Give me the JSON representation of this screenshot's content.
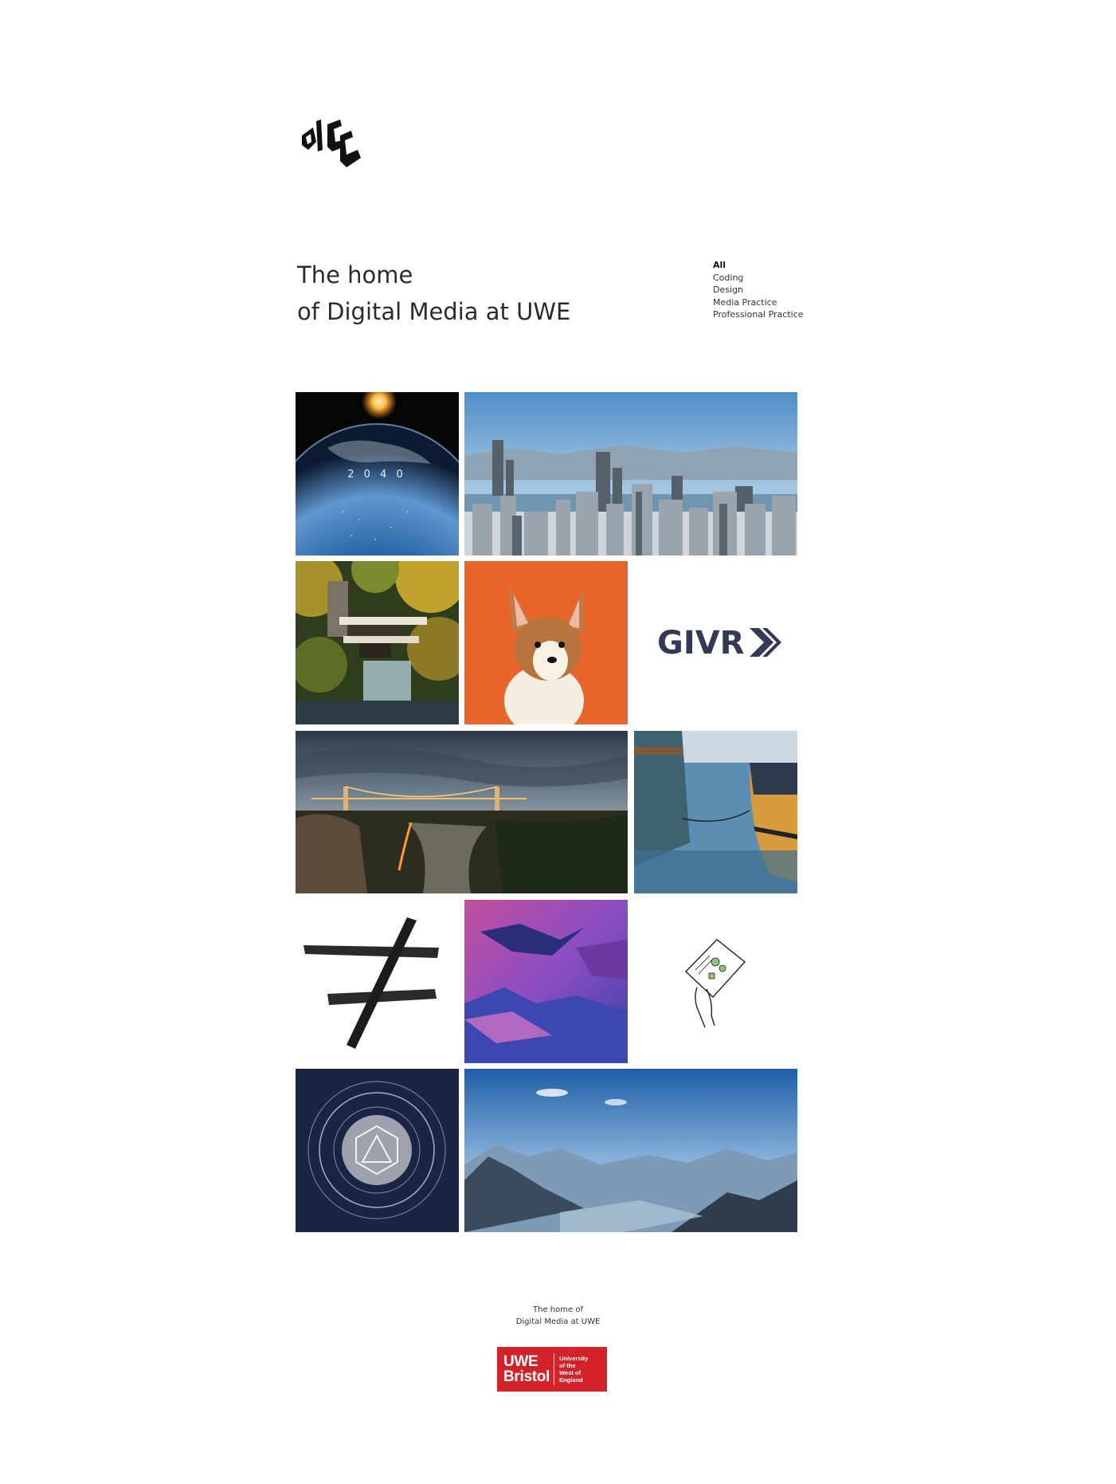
{
  "site": {
    "logo_icon": "dmc-logo"
  },
  "hero": {
    "line1": "The home",
    "line2": "of Digital Media at UWE"
  },
  "filters": {
    "items": [
      "All",
      "Coding",
      "Design",
      "Media Practice",
      "Professional Practice"
    ],
    "active": "All"
  },
  "tiles": {
    "earth_text": "2 0 4 0",
    "givr_text": "GIVR"
  },
  "footer": {
    "line1": "The home of",
    "line2": "Digital Media at UWE",
    "uwe_line1": "UWE",
    "uwe_line2": "Bristol",
    "uwe_sub1": "University",
    "uwe_sub2": "of the",
    "uwe_sub3": "West of",
    "uwe_sub4": "England"
  },
  "colors": {
    "uwe_red": "#d4222b",
    "givr_navy": "#343a55",
    "corgi_orange": "#e7652a"
  }
}
